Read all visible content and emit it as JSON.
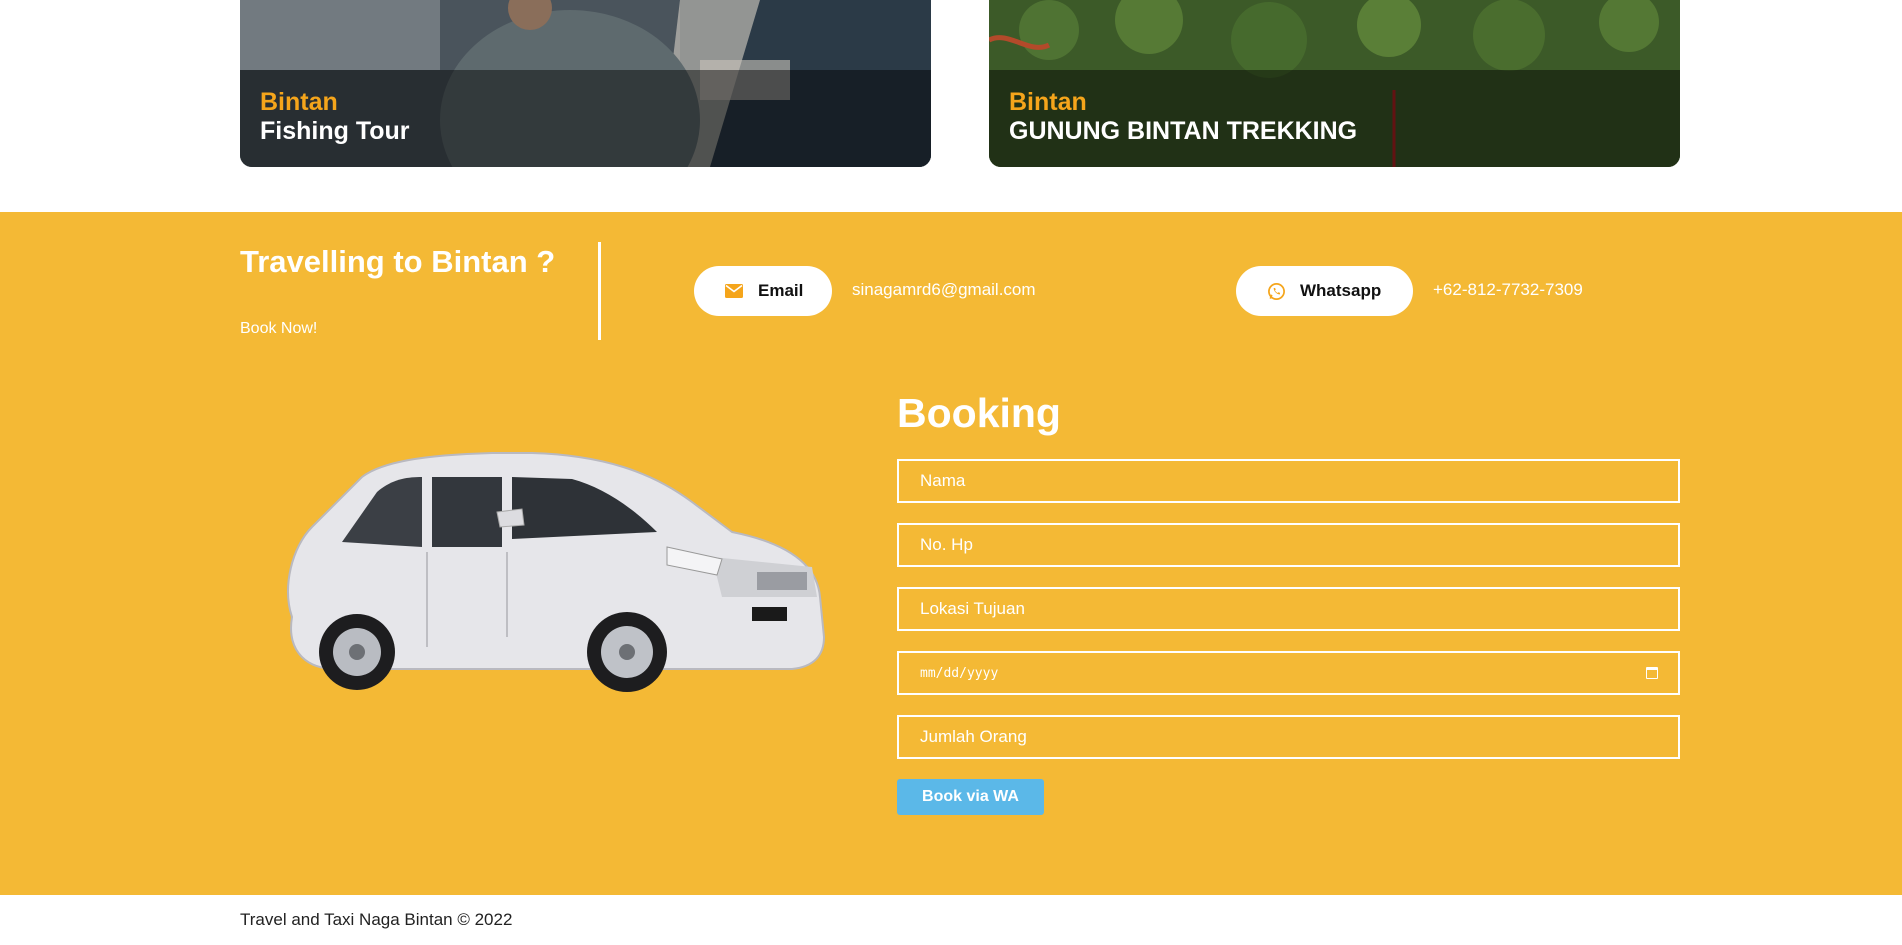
{
  "tours": [
    {
      "location": "Bintan",
      "name": "Fishing Tour"
    },
    {
      "location": "Bintan",
      "name": "GUNUNG BINTAN TREKKING"
    }
  ],
  "cta": {
    "title": "Travelling to Bintan ?",
    "subtitle": "Book Now!"
  },
  "contact": {
    "email_label": "Email",
    "email_value": "sinagamrd6@gmail.com",
    "whatsapp_label": "Whatsapp",
    "whatsapp_value": "+62-812-7732-7309"
  },
  "booking": {
    "title": "Booking",
    "fields": {
      "name_placeholder": "Nama",
      "phone_placeholder": "No. Hp",
      "destination_placeholder": "Lokasi Tujuan",
      "date_placeholder": "mm/dd/yyyy",
      "people_placeholder": "Jumlah Orang"
    },
    "submit_label": "Book via WA"
  },
  "footer": {
    "copyright": "Travel and Taxi Naga Bintan © 2022"
  },
  "colors": {
    "accent_yellow": "#f4b935",
    "location_orange": "#f5a51b",
    "button_blue": "#5bb8e8"
  }
}
